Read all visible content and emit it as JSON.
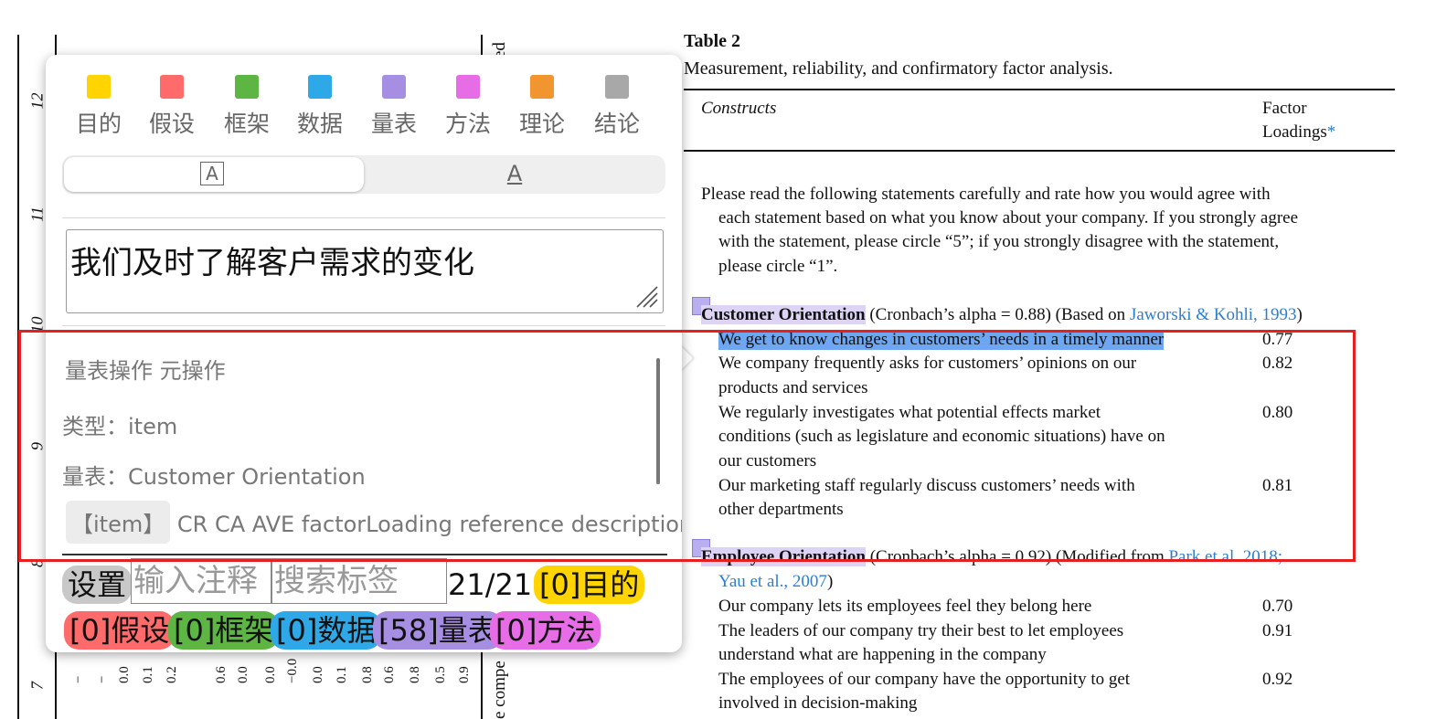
{
  "background_strip": {
    "y_axis_labels": [
      "12",
      "11",
      "10",
      "9",
      "8",
      "7"
    ],
    "bottom_ticks": [
      "−",
      "−",
      "0.0",
      "0.1",
      "0.2",
      "0.6",
      "0.0",
      "0.0",
      "−0.0",
      "0.0",
      "0.1",
      "0.8",
      "0.6",
      "0.8",
      "0.5",
      "0.9"
    ],
    "right_rotated_top": "ed",
    "right_rotated_bottom": "e compe"
  },
  "document": {
    "table_title": "Table 2",
    "table_caption": "Measurement, reliability, and confirmatory factor analysis.",
    "col_constructs": "Constructs",
    "col_factor_1": "Factor",
    "col_factor_2": "Loadings",
    "col_factor_star": "*",
    "instructions": [
      "Please read the following statements carefully and rate how you would agree with",
      "each statement based on what you know about your company. If you strongly agree",
      "with the statement, please circle “5”; if you strongly disagree with the statement,",
      "please circle “1”."
    ],
    "section1": {
      "heading": "Customer Orientation",
      "alpha": " (Cronbach’s alpha = 0.88) (Based on ",
      "ref": "Jaworski & Kohli, 1993",
      "close": ")",
      "items": [
        {
          "lines": [
            "We get to know changes in customers’ needs in a timely manner"
          ],
          "loading": "0.77"
        },
        {
          "lines": [
            "We company frequently asks for customers’ opinions on our",
            "products and services"
          ],
          "loading": "0.82"
        },
        {
          "lines": [
            "We regularly investigates what potential effects market",
            "conditions (such as legislature and economic situations) have on",
            "our customers"
          ],
          "loading": "0.80"
        },
        {
          "lines": [
            "Our marketing staff regularly discuss customers’ needs with",
            "other departments"
          ],
          "loading": "0.81"
        }
      ]
    },
    "section2": {
      "heading": "Employee Orientation",
      "alpha": " (Cronbach’s alpha = 0.92) (Modified from ",
      "ref1": "Park et al. 2018;",
      "ref2": "Yau et al., 2007",
      "close": ")",
      "items": [
        {
          "lines": [
            "Our company lets its employees feel they belong here"
          ],
          "loading": "0.70"
        },
        {
          "lines": [
            "The leaders of our company try their best to let employees",
            "understand what are happening in the company"
          ],
          "loading": "0.91"
        },
        {
          "lines": [
            "The employees of our company have the opportunity to get",
            "involved in decision-making"
          ],
          "loading": "0.92"
        }
      ]
    }
  },
  "popup": {
    "categories": [
      {
        "label": "目的",
        "color": "#ffd400"
      },
      {
        "label": "假设",
        "color": "#ff6b6b"
      },
      {
        "label": "框架",
        "color": "#5db643"
      },
      {
        "label": "数据",
        "color": "#2ea8e6"
      },
      {
        "label": "量表",
        "color": "#a68fe3"
      },
      {
        "label": "方法",
        "color": "#e66de6"
      },
      {
        "label": "理论",
        "color": "#f09530"
      },
      {
        "label": "结论",
        "color": "#a8a8a8"
      }
    ],
    "seg_left_icon": "A",
    "seg_right_icon": "A",
    "annotation_text": "我们及时了解客户需求的变化",
    "meta_title": "量表操作 元操作",
    "meta_type": "类型：item",
    "meta_scale": "量表：Customer Orientation",
    "item_tag": "【item】",
    "item_fields": "CR CA AVE factorLoading reference description",
    "settings_label": "设置",
    "input_placeholder": "输入注释",
    "search_placeholder": "搜索标签",
    "counter": "21/21",
    "tags": [
      {
        "label": "[0]目的",
        "color": "#ffd400"
      },
      {
        "label": "[0]假设",
        "color": "#ff6b6b"
      },
      {
        "label": "[0]框架",
        "color": "#5db643"
      },
      {
        "label": "[0]数据",
        "color": "#2ea8e6"
      },
      {
        "label": "[58]量表",
        "color": "#a68fe3"
      },
      {
        "label": "[0]方法",
        "color": "#e66de6"
      }
    ]
  }
}
